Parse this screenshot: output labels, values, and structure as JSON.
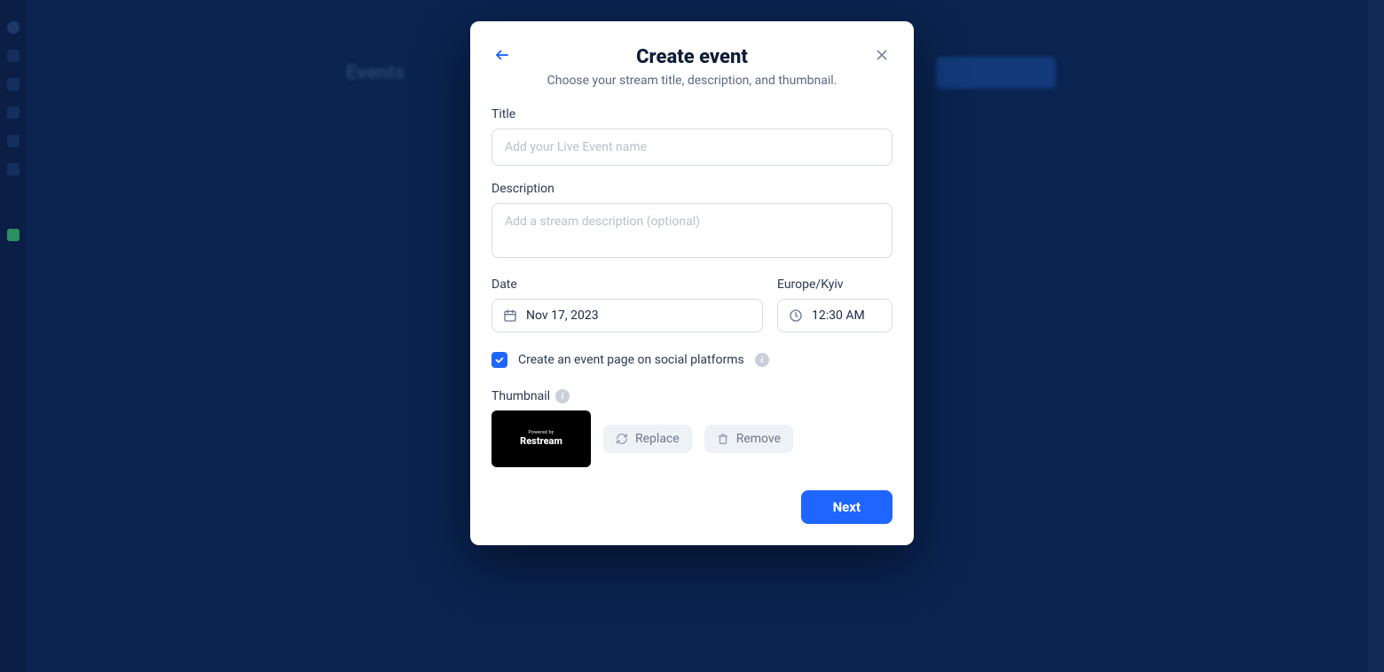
{
  "background": {
    "page_title": "Events"
  },
  "modal": {
    "title": "Create event",
    "subtitle": "Choose your stream title, description, and thumbnail.",
    "title_field": {
      "label": "Title",
      "placeholder": "Add your Live Event name",
      "value": ""
    },
    "description_field": {
      "label": "Description",
      "placeholder": "Add a stream description (optional)",
      "value": ""
    },
    "date_field": {
      "label": "Date",
      "value": "Nov 17, 2023"
    },
    "time_field": {
      "label": "Europe/Kyiv",
      "value": "12:30 AM"
    },
    "social_checkbox": {
      "label": "Create an event page on social platforms",
      "checked": true
    },
    "thumbnail": {
      "label": "Thumbnail",
      "preview_small": "Powered by",
      "preview_brand": "Restream",
      "replace_label": "Replace",
      "remove_label": "Remove"
    },
    "next_label": "Next"
  }
}
